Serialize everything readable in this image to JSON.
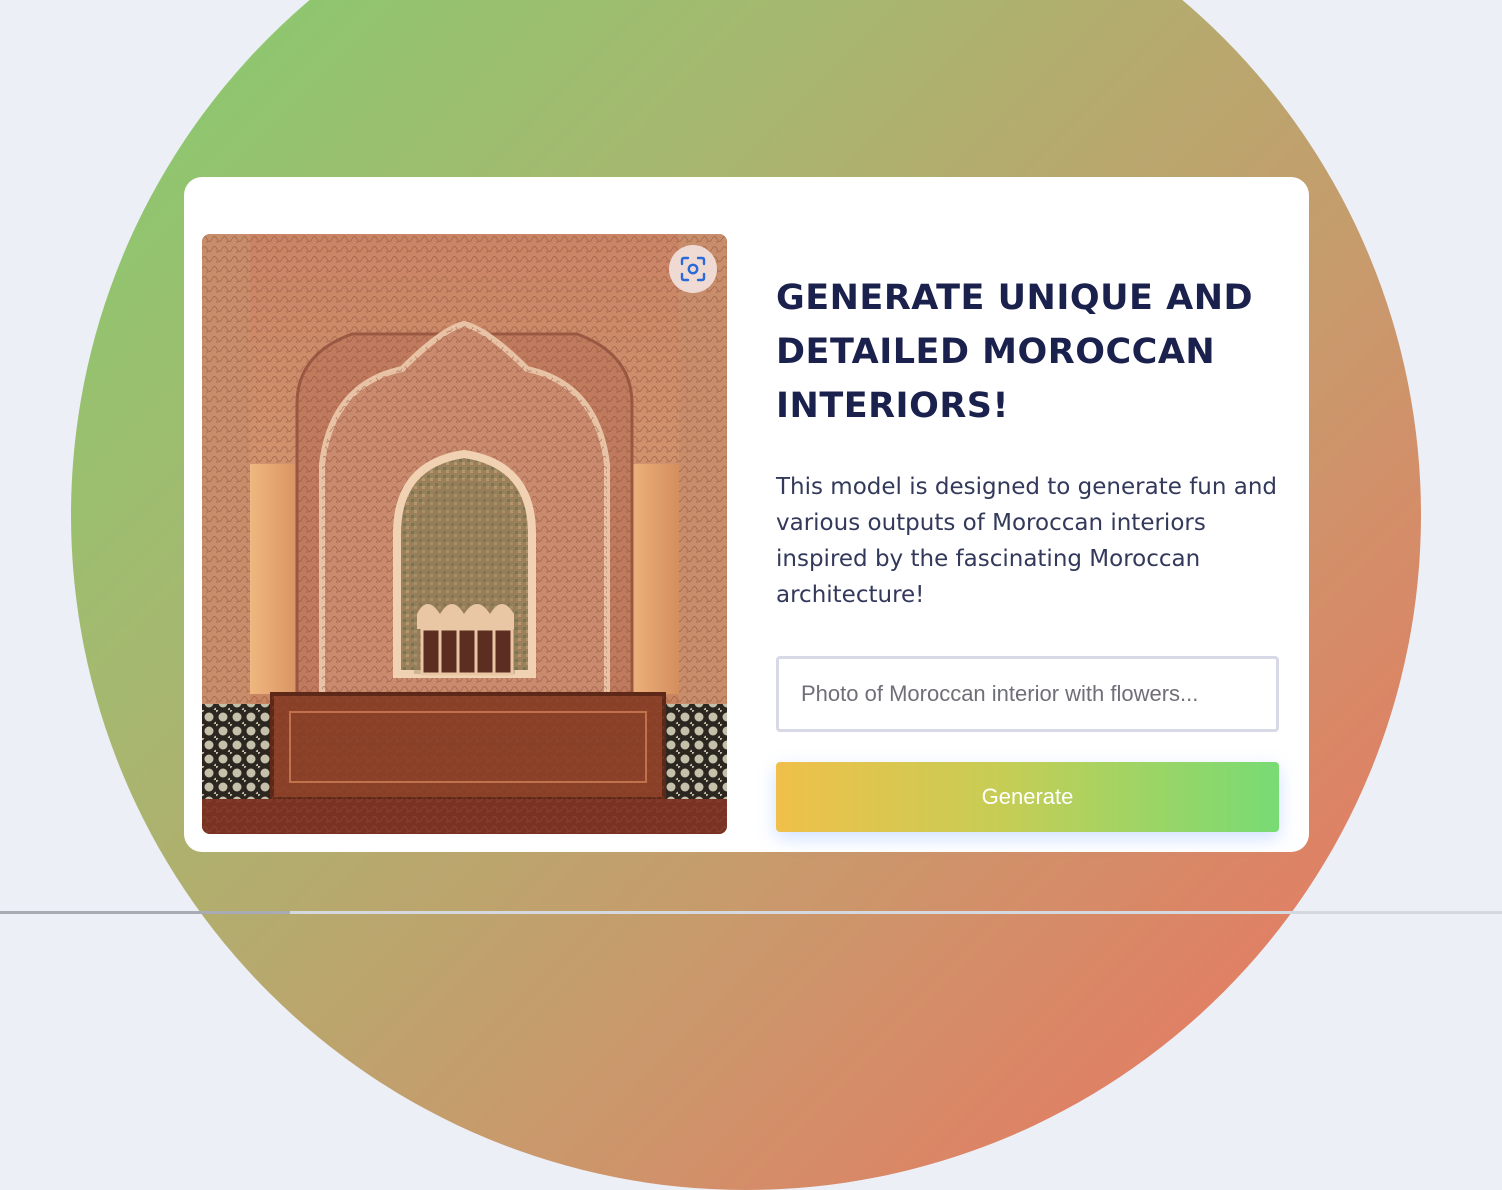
{
  "hero": {
    "headline": "GENERATE UNIQUE AND DETAILED MOROCCAN INTERIORS!",
    "description": "This model is designed to generate fun and various outputs of Moroccan interiors inspired by the fascinating Moroccan architecture!"
  },
  "image": {
    "lens_icon": "visual-search-icon"
  },
  "form": {
    "prompt_placeholder": "Photo of Moroccan interior with flowers...",
    "prompt_value": "",
    "generate_label": "Generate"
  },
  "colors": {
    "page_background": "#eceff6",
    "blob_gradient": [
      "#7fd06f",
      "#c9996c",
      "#f06f5f"
    ],
    "headline": "#1b214d",
    "button_gradient": [
      "#efc04a",
      "#78db74"
    ],
    "input_border": "#d7d9e6"
  }
}
